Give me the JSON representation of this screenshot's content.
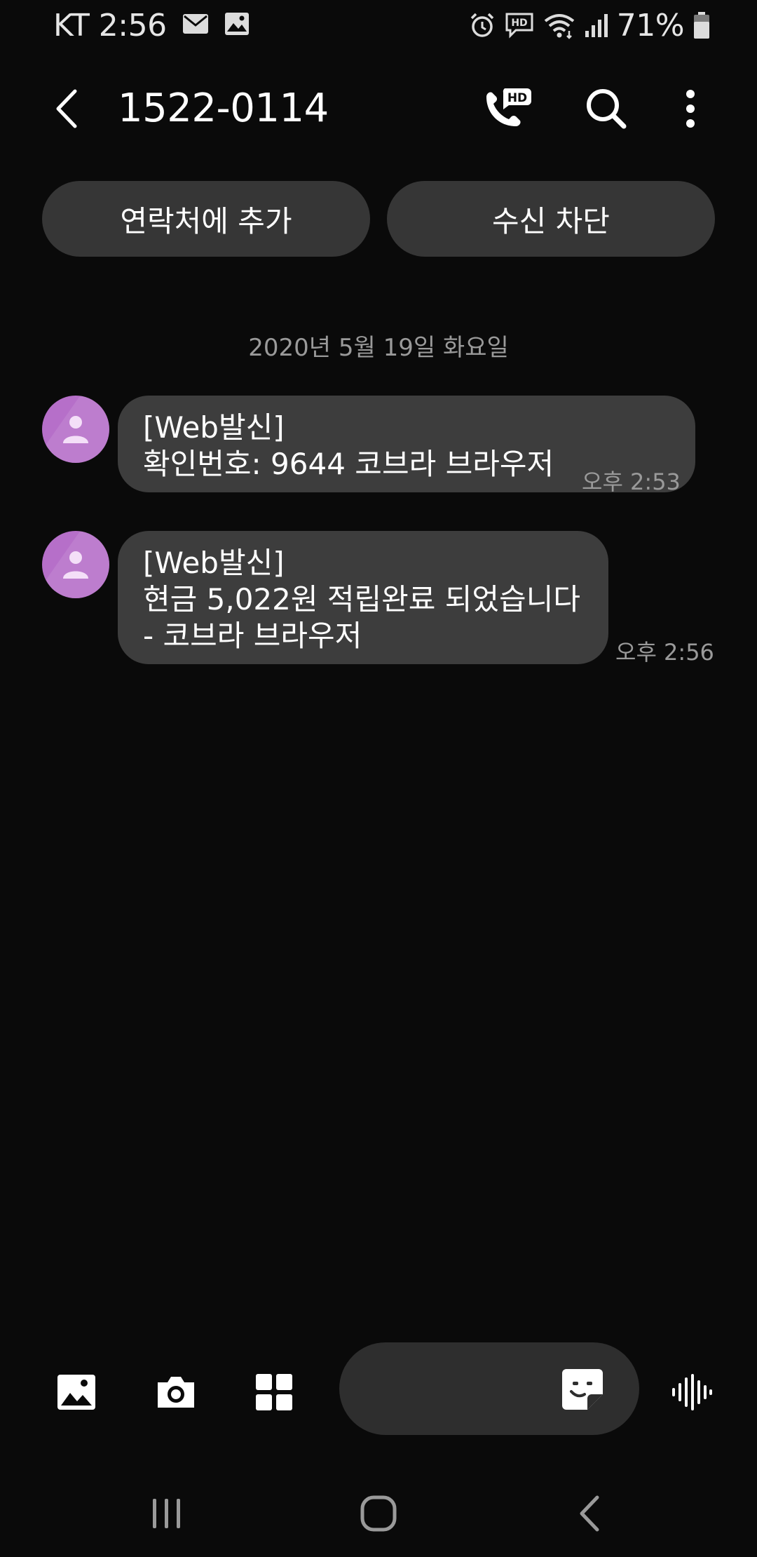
{
  "status_bar": {
    "carrier_time": "KT 2:56",
    "battery_percent": "71%",
    "battery_level": 0.71,
    "left_icons": [
      "mail-icon",
      "image-icon"
    ],
    "right_icons": [
      "alarm-icon",
      "hd-voice-icon",
      "wifi-icon",
      "signal-icon",
      "battery-icon"
    ]
  },
  "header": {
    "title": "1522-0114",
    "back_icon": "back-arrow-icon",
    "call_icon": "hd-call-icon",
    "search_icon": "search-icon",
    "more_icon": "more-vert-icon"
  },
  "actions": {
    "add_contact": "연락처에 추가",
    "block": "수신 차단"
  },
  "conversation": {
    "date": "2020년 5월 19일 화요일",
    "messages": [
      {
        "lines": [
          "[Web발신]",
          "확인번호: 9644 코브라 브라우저"
        ],
        "time": "오후 2:53"
      },
      {
        "lines": [
          "[Web발신]",
          "현금 5,022원 적립완료 되었습니다",
          "- 코브라 브라우저"
        ],
        "time": "오후 2:56"
      }
    ]
  },
  "compose": {
    "icons": [
      "gallery-icon",
      "camera-icon",
      "apps-grid-icon",
      "sticker-icon",
      "voice-wave-icon"
    ]
  },
  "nav": {
    "icons": [
      "recents-icon",
      "home-icon",
      "back-icon"
    ]
  },
  "colors": {
    "background": "#0a0a0a",
    "bubble": "#3d3d3d",
    "pill": "#363636",
    "avatar": "#b66fc9",
    "secondary_text": "#9a9a9a"
  }
}
